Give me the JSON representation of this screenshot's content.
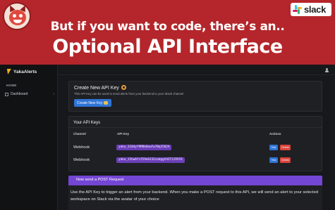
{
  "banner": {
    "headline_small": "But if you want to code, there’s an..",
    "headline_large": "Optional API Interface",
    "slack_logo_text": "slack",
    "accent_color": "#b4262b"
  },
  "sidebar": {
    "brand": "YakaAlerts",
    "section_title": "HOME",
    "items": [
      {
        "label": "Dashboard",
        "icon": "dashboard-icon"
      }
    ]
  },
  "create_card": {
    "title": "Create New API Key",
    "description": "This API Key can be used to send alerts from your backend to your Slack channel",
    "button_label": "Create New Key"
  },
  "keys_card": {
    "title": "Your API Keys",
    "columns": [
      "Channel",
      "API Key",
      "Actions"
    ],
    "rows": [
      {
        "channel": "Webhook",
        "api_key": "yaka_3184yY9M8k6mwFw7Bq2582A",
        "test_label": "Test",
        "delete_label": "Delete"
      },
      {
        "channel": "Webhook",
        "api_key": "yaka_15hwAYrZ59e6232zadggtH2T2J95FD",
        "test_label": "Test",
        "delete_label": "Delete"
      }
    ]
  },
  "post_card": {
    "title": "Now send a POST Request",
    "body": "Use the API Key to trigger an alert from your backend. When you make a POST request to this API, we will send an alert to your selected workspace on Slack via the avatar of your choice",
    "accent_color": "#7446d4"
  }
}
